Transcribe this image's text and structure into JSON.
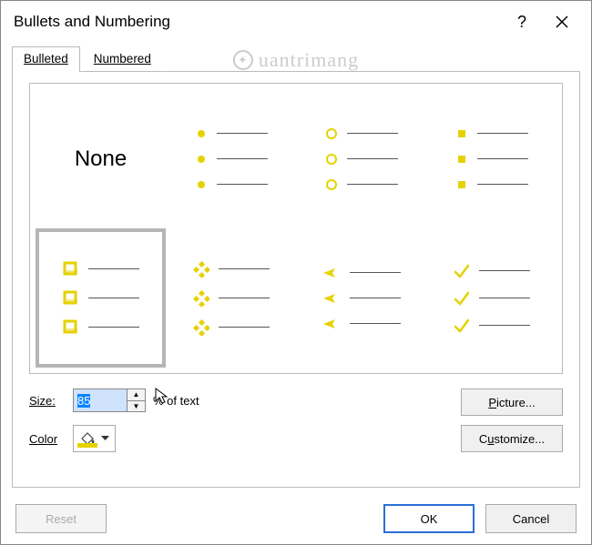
{
  "title": "Bullets and Numbering",
  "tabs": {
    "bulleted": "Bulleted",
    "numbered": "Numbered"
  },
  "bullet_gallery": {
    "none_label": "None"
  },
  "controls": {
    "size_label": "Size:",
    "size_value": "85",
    "size_suffix": "% of text",
    "color_label": "Color",
    "picture_label": "Picture...",
    "customize_label": "Customize..."
  },
  "footer": {
    "reset": "Reset",
    "ok": "OK",
    "cancel": "Cancel"
  },
  "watermark": "uantrimang"
}
